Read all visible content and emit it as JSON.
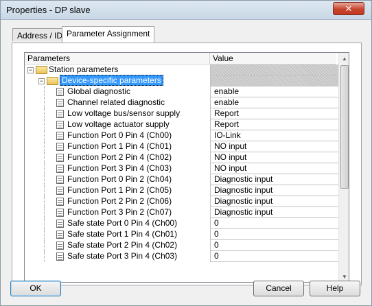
{
  "window": {
    "title": "Properties - DP slave",
    "close_glyph": "✕"
  },
  "tabs": [
    {
      "label": "Address / ID",
      "active": false
    },
    {
      "label": "Parameter Assignment",
      "active": true
    }
  ],
  "grid": {
    "col_parameters": "Parameters",
    "col_value": "Value",
    "rows": [
      {
        "name": "Station parameters",
        "value": "",
        "level": 0,
        "kind": "folder",
        "toggle": "−"
      },
      {
        "name": "Device-specific parameters",
        "value": "",
        "level": 1,
        "kind": "folder",
        "toggle": "−",
        "selected": true
      },
      {
        "name": "Global diagnostic",
        "value": "enable",
        "level": 2,
        "kind": "doc"
      },
      {
        "name": "Channel related diagnostic",
        "value": "enable",
        "level": 2,
        "kind": "doc"
      },
      {
        "name": "Low voltage bus/sensor supply",
        "value": "Report",
        "level": 2,
        "kind": "doc"
      },
      {
        "name": "Low voltage actuator supply",
        "value": "Report",
        "level": 2,
        "kind": "doc"
      },
      {
        "name": "Function Port 0 Pin 4 (Ch00)",
        "value": "IO-Link",
        "level": 2,
        "kind": "doc"
      },
      {
        "name": "Function Port 1 Pin 4 (Ch01)",
        "value": "NO input",
        "level": 2,
        "kind": "doc"
      },
      {
        "name": "Function Port 2 Pin 4 (Ch02)",
        "value": "NO input",
        "level": 2,
        "kind": "doc"
      },
      {
        "name": "Function Port 3 Pin 4 (Ch03)",
        "value": "NO input",
        "level": 2,
        "kind": "doc"
      },
      {
        "name": "Function Port 0 Pin 2 (Ch04)",
        "value": "Diagnostic input",
        "level": 2,
        "kind": "doc"
      },
      {
        "name": "Function Port 1 Pin 2 (Ch05)",
        "value": "Diagnostic input",
        "level": 2,
        "kind": "doc"
      },
      {
        "name": "Function Port 2 Pin 2 (Ch06)",
        "value": "Diagnostic input",
        "level": 2,
        "kind": "doc"
      },
      {
        "name": "Function Port 3 Pin 2 (Ch07)",
        "value": "Diagnostic input",
        "level": 2,
        "kind": "doc"
      },
      {
        "name": "Safe state Port 0 Pin 4 (Ch00)",
        "value": "0",
        "level": 2,
        "kind": "doc"
      },
      {
        "name": "Safe state Port 1 Pin 4 (Ch01)",
        "value": "0",
        "level": 2,
        "kind": "doc"
      },
      {
        "name": "Safe state Port 2 Pin 4 (Ch02)",
        "value": "0",
        "level": 2,
        "kind": "doc"
      },
      {
        "name": "Safe state Port 3 Pin 4 (Ch03)",
        "value": "0",
        "level": 2,
        "kind": "doc"
      }
    ]
  },
  "scrollbar": {
    "up_glyph": "▲",
    "down_glyph": "▼"
  },
  "buttons": {
    "ok": "OK",
    "cancel": "Cancel",
    "help": "Help"
  }
}
